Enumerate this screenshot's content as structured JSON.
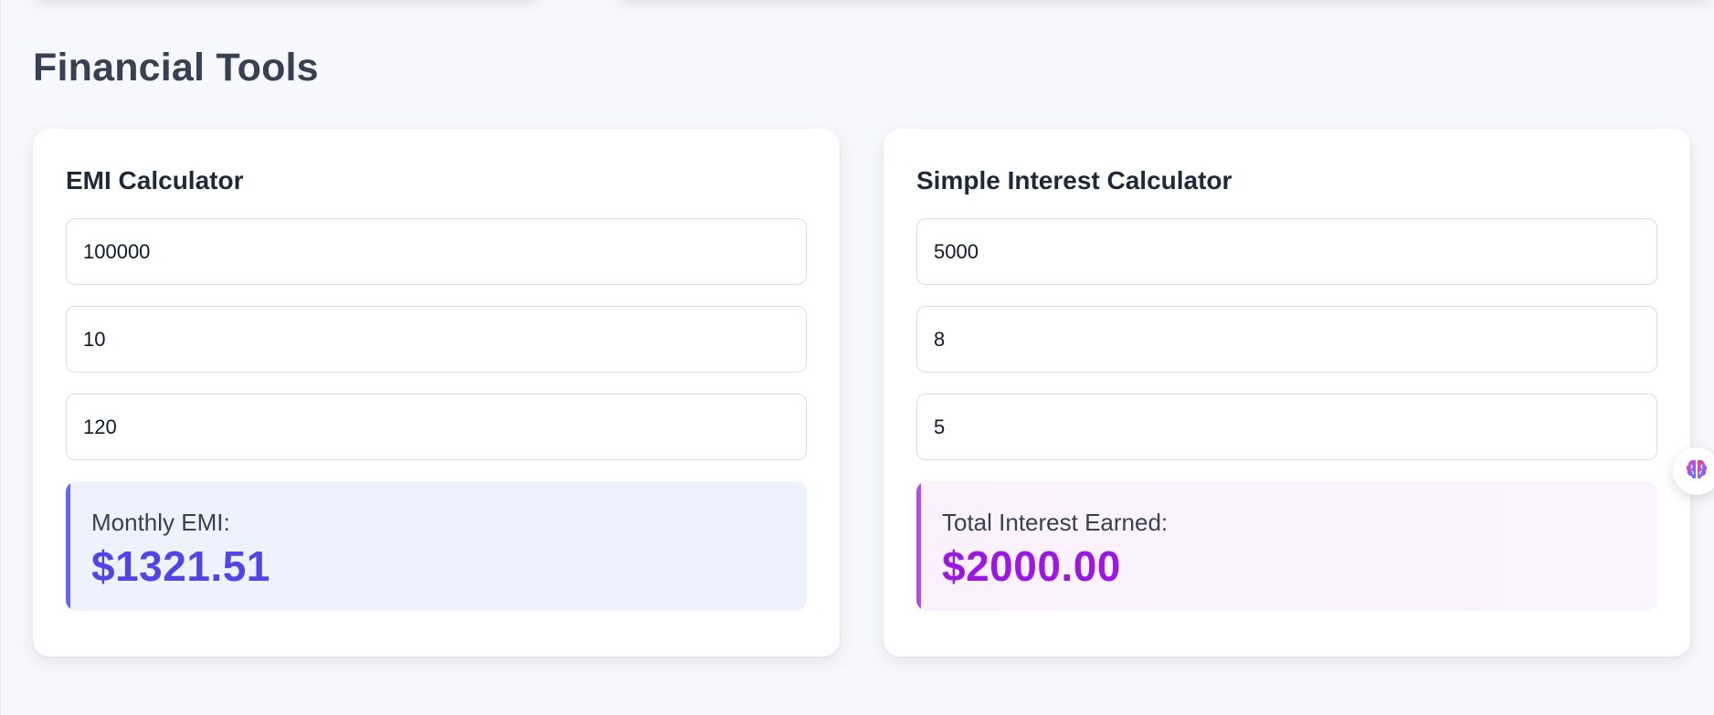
{
  "page": {
    "title": "Financial Tools"
  },
  "emi_calculator": {
    "title": "EMI Calculator",
    "inputs": {
      "principal": "100000",
      "rate": "10",
      "tenure": "120"
    },
    "result": {
      "label": "Monthly EMI:",
      "value": "$1321.51"
    }
  },
  "simple_interest_calculator": {
    "title": "Simple Interest Calculator",
    "inputs": {
      "principal": "5000",
      "rate": "8",
      "time": "5"
    },
    "result": {
      "label": "Total Interest Earned:",
      "value": "$2000.00"
    }
  },
  "floating_widget": {
    "icon": "brain-icon"
  },
  "colors": {
    "background": "#f7f8fb",
    "emi_accent": "#4f46e5",
    "emi_result_bg": "#eef2fd",
    "si_accent": "#9b18e0",
    "si_result_bg": "#fbf1fd"
  }
}
